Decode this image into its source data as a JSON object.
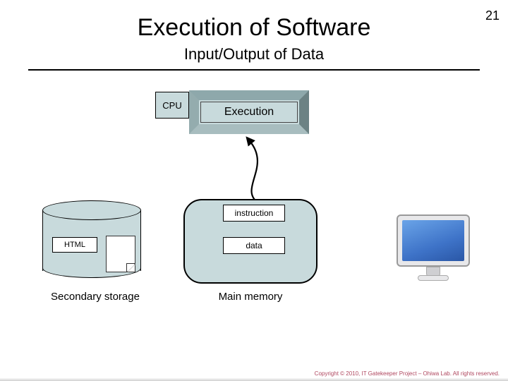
{
  "page_number": "21",
  "title": "Execution of Software",
  "subtitle": "Input/Output of Data",
  "cpu": {
    "label": "CPU",
    "execution_label": "Execution"
  },
  "memory": {
    "instruction_label": "instruction",
    "data_label": "data",
    "caption": "Main memory"
  },
  "storage": {
    "file_label": "HTML",
    "caption": "Secondary storage"
  },
  "footer": "Copyright © 2010, IT Gatekeeper Project – Ohiwa Lab. All rights reserved."
}
